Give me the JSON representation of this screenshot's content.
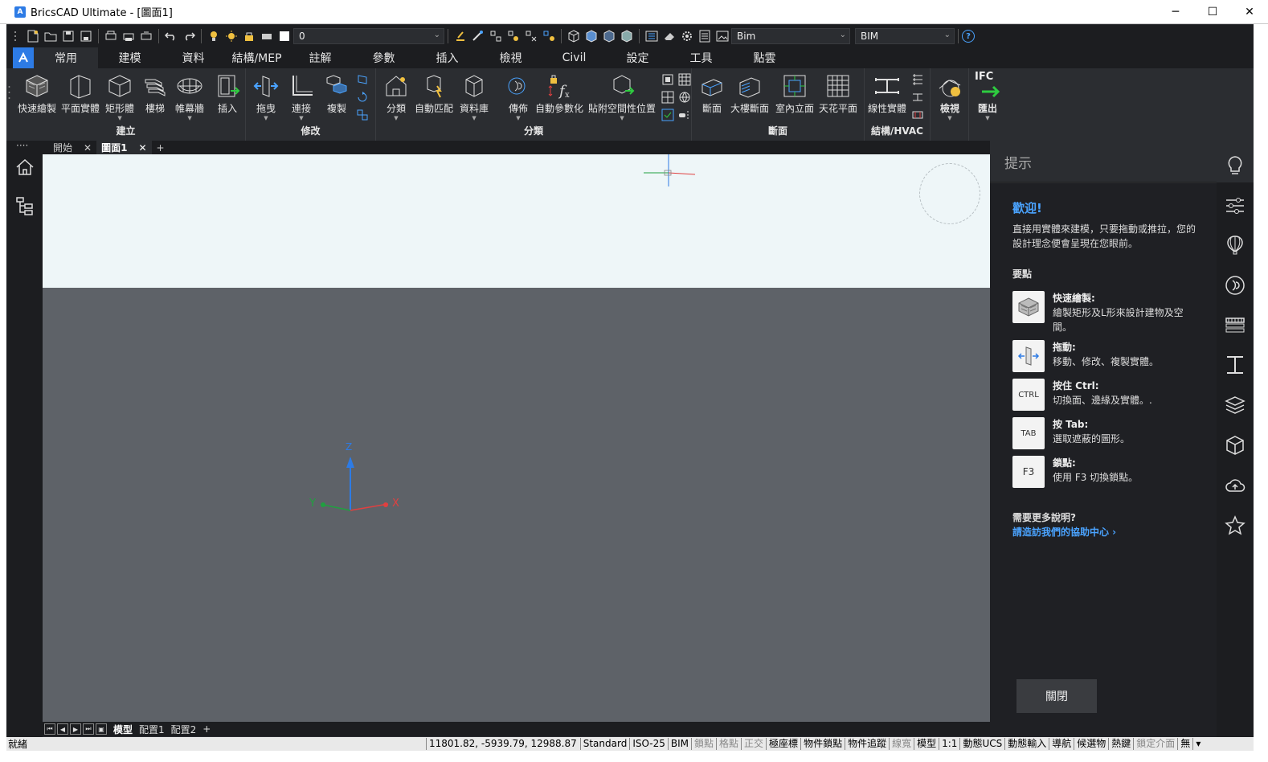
{
  "window": {
    "logo_letter": "A",
    "title": "BricsCAD Ultimate - [圖面1]",
    "minimize": "─",
    "maximize": "☐",
    "close": "✕"
  },
  "qat": {
    "layer_value": "0",
    "workspace_value": "Bim",
    "profile_value": "BIM",
    "help_glyph": "?"
  },
  "ribbon_tabs": [
    "常用",
    "建模",
    "資料",
    "結構/MEP",
    "註解",
    "參數",
    "插入",
    "檢視",
    "Civil",
    "設定",
    "工具",
    "點雲"
  ],
  "ribbon": {
    "groups": {
      "create": "建立",
      "modify": "修改",
      "classify": "分類",
      "section": "斷面",
      "structure": "結構/HVAC"
    },
    "tools": {
      "quick_draw": "快速繪製",
      "plane_solid": "平面實體",
      "box": "矩形體",
      "stair": "樓梯",
      "curtain_wall": "帷幕牆",
      "insert": "插入",
      "drag": "拖曳",
      "connect": "連接",
      "copy": "複製",
      "classify": "分類",
      "auto_match": "自動匹配",
      "library": "資料庫",
      "propagate": "傳佈",
      "auto_param": "自動參數化",
      "attach_space": "貼附空間性位置",
      "section": "斷面",
      "building_section": "大樓斷面",
      "interior_elevation": "室內立面",
      "ceiling_plan": "天花平面",
      "linear_solid": "線性實體",
      "view": "檢視",
      "export_label": "IFC",
      "export": "匯出"
    },
    "more": "····"
  },
  "doc_tabs": {
    "start": "開始",
    "drawing": "圖面1",
    "close_glyph": "✕",
    "add": "+",
    "more": "····"
  },
  "layout_tabs": {
    "model": "模型",
    "layout1": "配置1",
    "layout2": "配置2",
    "add": "+"
  },
  "ucs": {
    "x": "X",
    "y": "Y",
    "z": "Z"
  },
  "hints": {
    "title": "提示",
    "welcome": "歡迎!",
    "intro": "直接用實體來建模，只要拖動或推拉，您的設計理念便會呈現在您眼前。",
    "key_points": "要點",
    "items": [
      {
        "thumb": "",
        "title": "快速繪製:",
        "desc": "繪製矩形及L形來設計建物及空間。"
      },
      {
        "thumb": "",
        "title": "拖動:",
        "desc": "移動、修改、複製實體。"
      },
      {
        "thumb": "CTRL",
        "title": "按住 Ctrl:",
        "desc": "切換面、邊緣及實體。."
      },
      {
        "thumb": "TAB",
        "title": "按 Tab:",
        "desc": "選取遮蔽的圖形。"
      },
      {
        "thumb": "F3",
        "title": "鎖點:",
        "desc": "使用 F3 切換鎖點。"
      }
    ],
    "more_help": "需要更多說明?",
    "help_link": "請造訪我們的協助中心 ›",
    "close": "關閉"
  },
  "statusbar": {
    "ready": "就緒",
    "coords": "11801.82, -5939.79, 12988.87",
    "items": [
      {
        "label": "Standard",
        "on": true
      },
      {
        "label": "ISO-25",
        "on": true
      },
      {
        "label": "BIM",
        "on": true
      },
      {
        "label": "鎖點",
        "on": false
      },
      {
        "label": "格點",
        "on": false
      },
      {
        "label": "正交",
        "on": false
      },
      {
        "label": "極座標",
        "on": true
      },
      {
        "label": "物件鎖點",
        "on": true
      },
      {
        "label": "物件追蹤",
        "on": true
      },
      {
        "label": "線寬",
        "on": false
      },
      {
        "label": "模型",
        "on": true
      },
      {
        "label": "1:1",
        "on": true
      },
      {
        "label": "動態UCS",
        "on": true
      },
      {
        "label": "動態輸入",
        "on": true
      },
      {
        "label": "導航",
        "on": true
      },
      {
        "label": "候選物",
        "on": true
      },
      {
        "label": "熱鍵",
        "on": true
      },
      {
        "label": "鎖定介面",
        "on": false
      },
      {
        "label": "無",
        "on": true
      }
    ],
    "menu": "▾"
  },
  "colors": {
    "accent": "#2d7be5",
    "link": "#4aa3ff",
    "ucs_x": "#e04040",
    "ucs_y": "#20a040",
    "ucs_z": "#2d7be5"
  }
}
